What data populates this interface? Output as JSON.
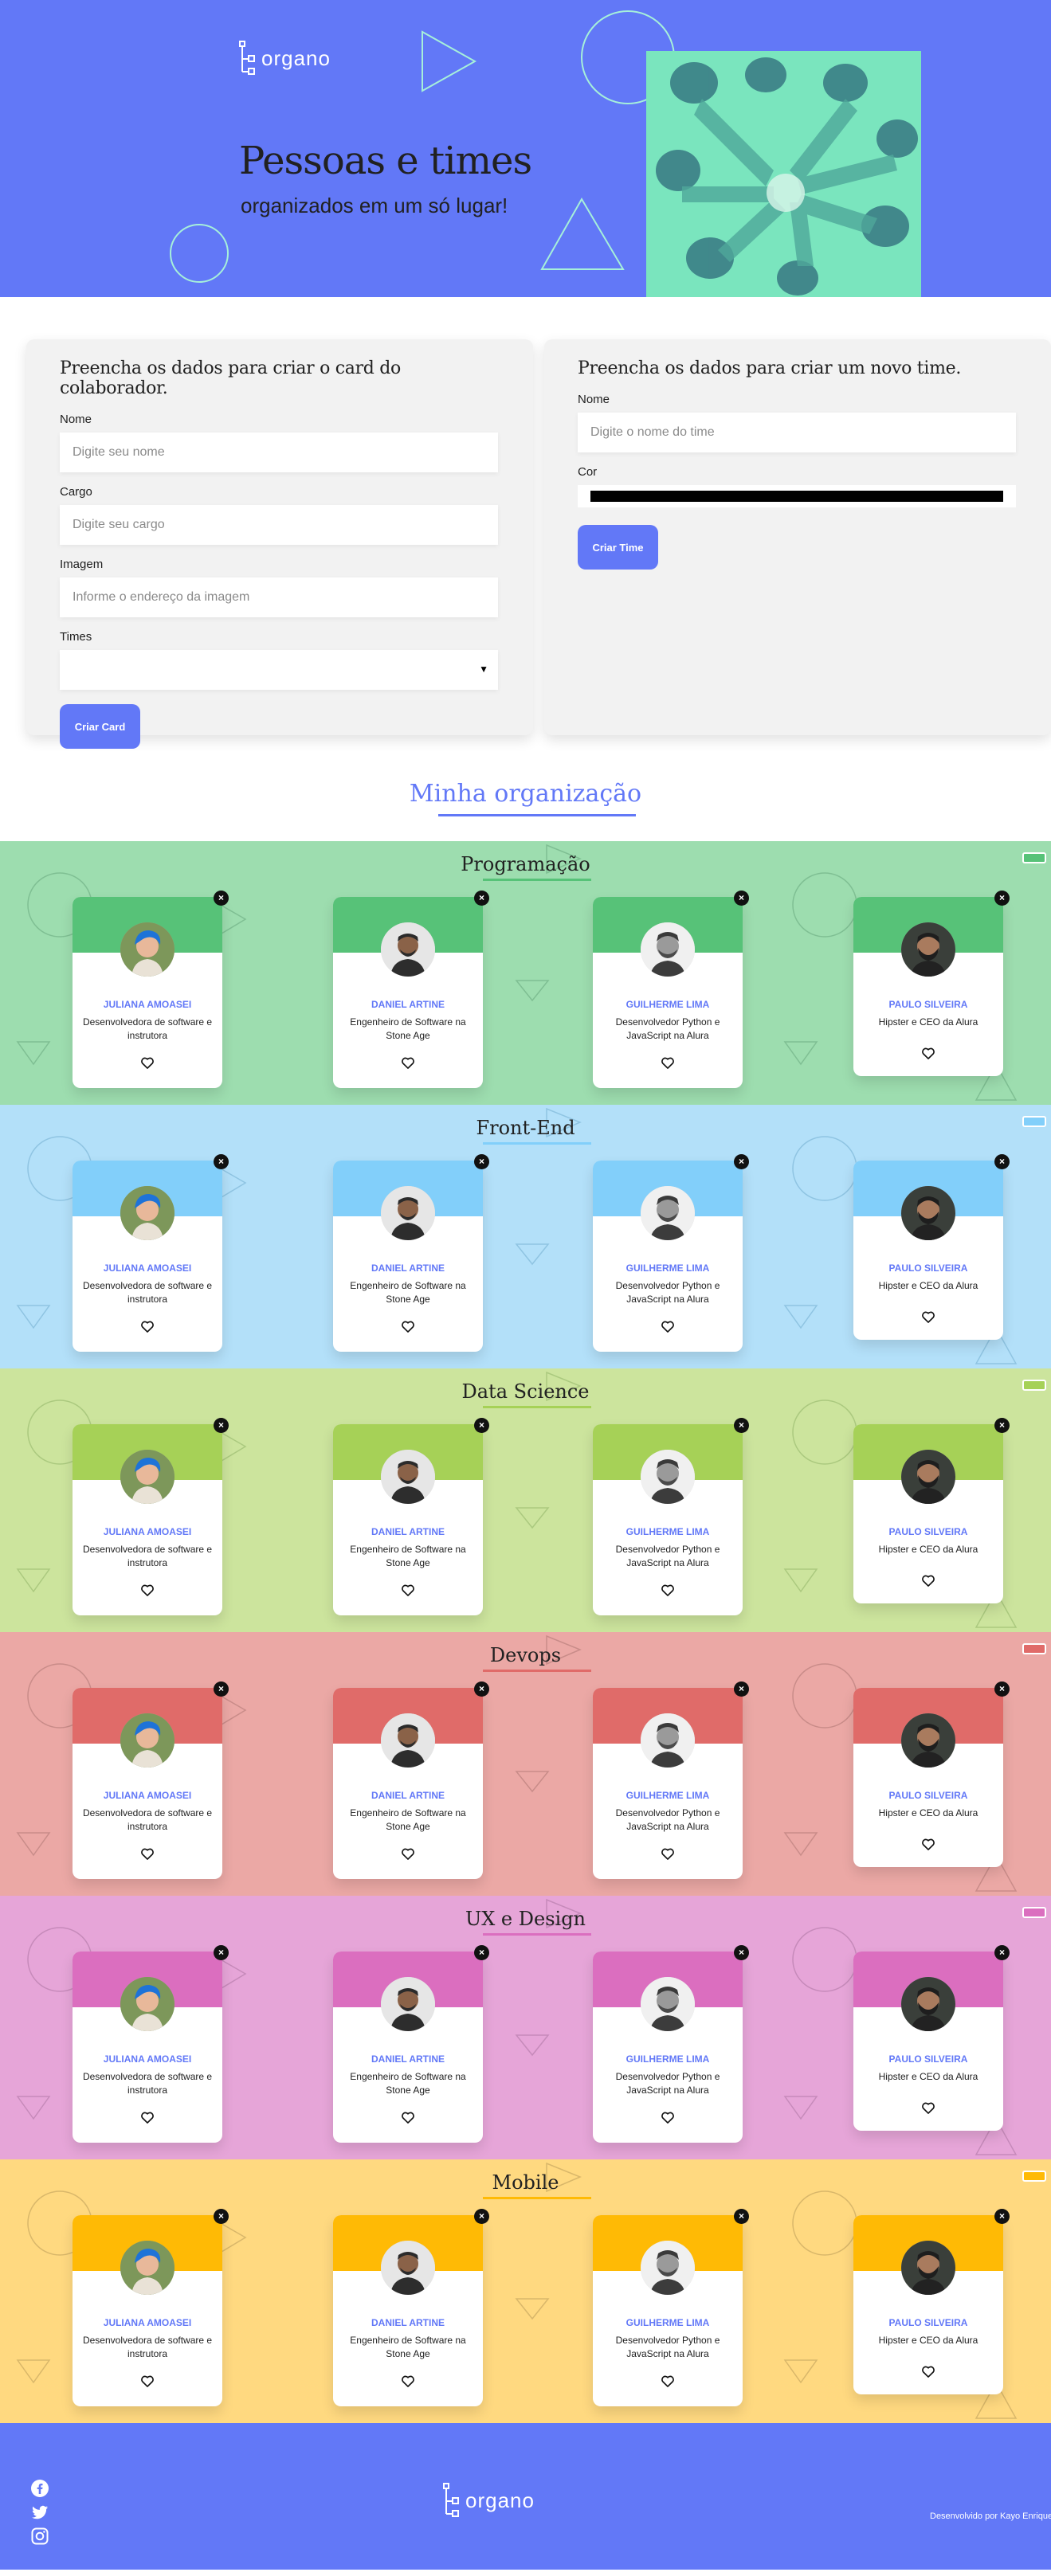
{
  "header": {
    "logo_text": "organo",
    "title": "Pessoas e times",
    "subtitle": "organizados em um só lugar!"
  },
  "collaborator_form": {
    "heading": "Preencha os dados para criar o card do colaborador.",
    "name_label": "Nome",
    "name_placeholder": "Digite seu nome",
    "role_label": "Cargo",
    "role_placeholder": "Digite seu cargo",
    "image_label": "Imagem",
    "image_placeholder": "Informe o endereço da imagem",
    "teams_label": "Times",
    "teams_value": "",
    "submit_label": "Criar Card"
  },
  "team_form": {
    "heading": "Preencha os dados para criar um novo time.",
    "name_label": "Nome",
    "name_placeholder": "Digite o nome do time",
    "color_label": "Cor",
    "color_value": "#000000",
    "submit_label": "Criar Time"
  },
  "organization": {
    "title": "Minha organização"
  },
  "teams": [
    {
      "name": "Programação",
      "bg": "#9DDDAF",
      "accent": "#57C278",
      "deco": "#7FBF93"
    },
    {
      "name": "Front-End",
      "bg": "#B3E0F9",
      "accent": "#82CFFA",
      "deco": "#8FC4E2"
    },
    {
      "name": "Data Science",
      "bg": "#CCE49D",
      "accent": "#A6D157",
      "deco": "#ABC97F"
    },
    {
      "name": "Devops",
      "bg": "#EBA8A5",
      "accent": "#E06B69",
      "deco": "#C98C89"
    },
    {
      "name": "UX e Design",
      "bg": "#E6A5D8",
      "accent": "#DB6EBF",
      "deco": "#C68ABA"
    },
    {
      "name": "Mobile",
      "bg": "#FFD980",
      "accent": "#FFBA05",
      "deco": "#D9B76A"
    }
  ],
  "members": [
    {
      "name": "JULIANA AMOASEI",
      "role": "Desenvolvedora de software e instrutora",
      "avatar": "woman-blue-hair"
    },
    {
      "name": "DANIEL ARTINE",
      "role": "Engenheiro de Software na Stone Age",
      "avatar": "man-dark"
    },
    {
      "name": "GUILHERME LIMA",
      "role": "Desenvolvedor Python e JavaScript na Alura",
      "avatar": "man-grey"
    },
    {
      "name": "PAULO SILVEIRA",
      "role": "Hipster e CEO da Alura",
      "avatar": "man-beard"
    }
  ],
  "card_icons": {
    "close": "×",
    "favorite": "heart-outline-icon"
  },
  "footer": {
    "logo_text": "organo",
    "credit": "Desenvolvido por Kayo Enrique",
    "socials": [
      "facebook-icon",
      "twitter-icon",
      "instagram-icon"
    ]
  },
  "colors": {
    "primary": "#6278F7",
    "hero_photo_tint": "#7AE5BE"
  }
}
